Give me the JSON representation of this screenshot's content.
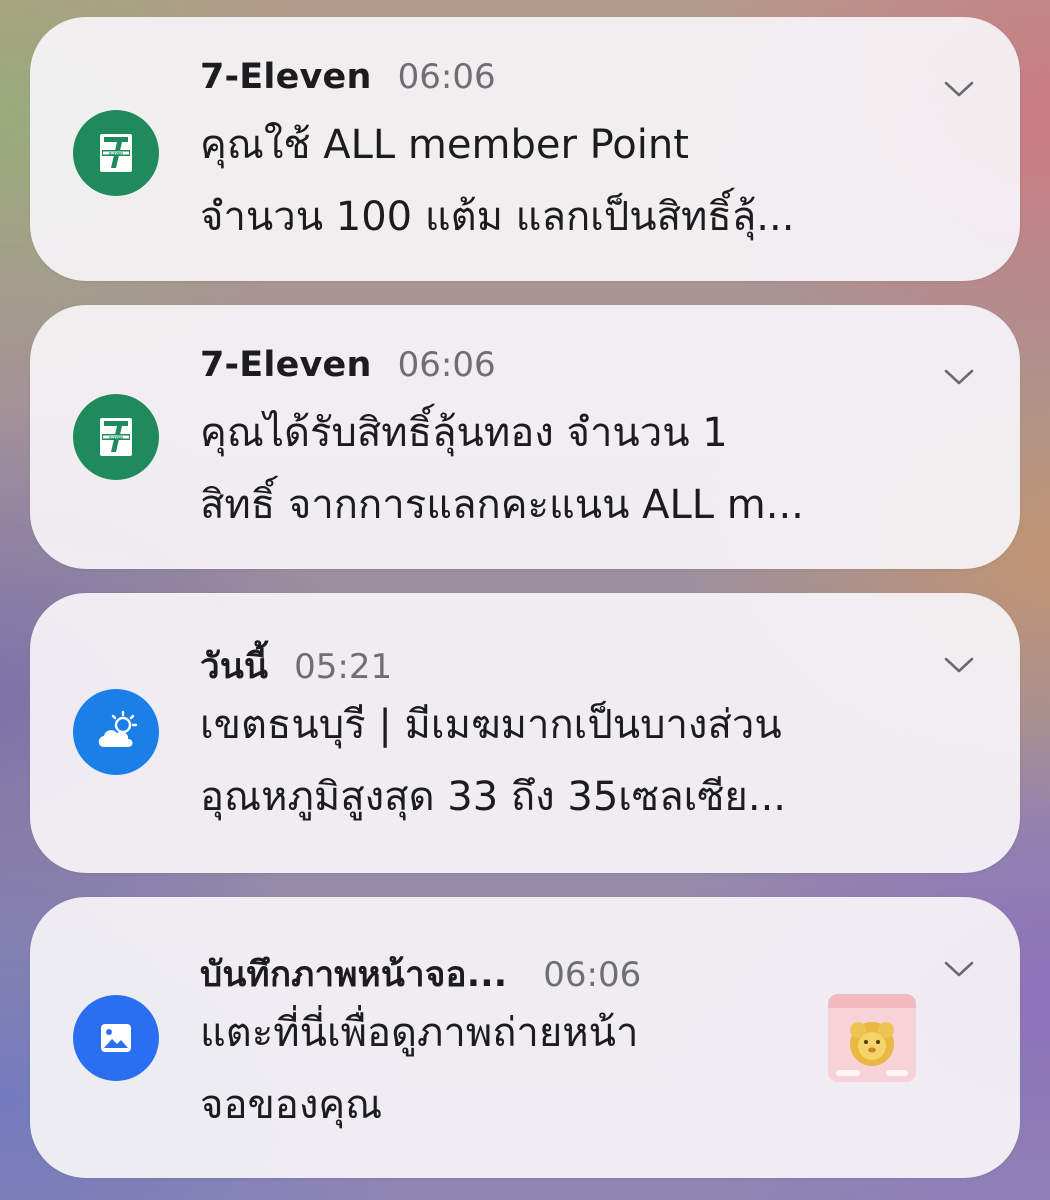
{
  "notifications": [
    {
      "app": "7-Eleven",
      "time": "06:06",
      "icon": "seven-eleven-logo",
      "icon_color": "#1f8a5b",
      "lines": [
        "คุณใช้ ALL member Point",
        "จำนวน 100 แต้ม แลกเป็นสิทธิ์ลุ้..."
      ]
    },
    {
      "app": "7-Eleven",
      "time": "06:06",
      "icon": "seven-eleven-logo",
      "icon_color": "#1f8a5b",
      "lines": [
        "คุณได้รับสิทธิ์ลุ้นทอง จำนวน 1",
        "สิทธิ์ จากการแลกคะแนน ALL m..."
      ]
    },
    {
      "app": "วันนี้",
      "time": "05:21",
      "icon": "partly-cloudy-icon",
      "icon_color": "#1b7fe8",
      "lines": [
        "เขตธนบุรี | มีเมฆมากเป็นบางส่วน",
        "อุณหภูมิสูงสุด 33 ถึง 35เซลเซีย..."
      ]
    },
    {
      "app": "บันทึกภาพหน้าจอ...",
      "time": "06:06",
      "icon": "image-icon",
      "icon_color": "#2a6ff0",
      "lines": [
        "แตะที่นี่เพื่อดูภาพถ่ายหน้า",
        "จอของคุณ"
      ],
      "has_thumbnail": true
    }
  ]
}
